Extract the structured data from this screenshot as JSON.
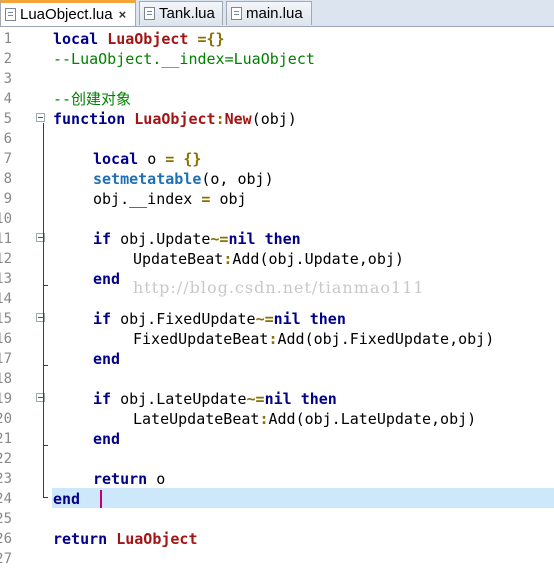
{
  "tabs": [
    {
      "label": "LuaObject.lua",
      "active": true,
      "close": "×"
    },
    {
      "label": "Tank.lua",
      "active": false
    },
    {
      "label": "main.lua",
      "active": false
    }
  ],
  "line_numbers": [
    "1",
    "2",
    "3",
    "4",
    "5",
    "6",
    "7",
    "8",
    "9",
    "10",
    "11",
    "12",
    "13",
    "14",
    "15",
    "16",
    "17",
    "18",
    "19",
    "20",
    "21",
    "22",
    "23",
    "24",
    "25",
    "26",
    "27"
  ],
  "code": {
    "l1": [
      "local",
      "LuaObject",
      "=",
      "{}"
    ],
    "l2": "--LuaObject.__index=LuaObject",
    "l4": "--创建对象",
    "l5": [
      "function",
      "LuaObject",
      ":",
      "New",
      "(obj)"
    ],
    "l7": [
      "local",
      "o",
      "=",
      "{}"
    ],
    "l8": [
      "setmetatable",
      "(o, obj)"
    ],
    "l9": [
      "obj.__index",
      "=",
      "obj"
    ],
    "l11": [
      "if",
      "obj.Update",
      "~=",
      "nil",
      "then"
    ],
    "l12": [
      "UpdateBeat",
      ":",
      "Add",
      "(obj.Update,obj)"
    ],
    "l13": "end",
    "l15": [
      "if",
      "obj.FixedUpdate",
      "~=",
      "nil",
      "then"
    ],
    "l16": [
      "FixedUpdateBeat",
      ":",
      "Add",
      "(obj.FixedUpdate,obj)"
    ],
    "l17": "end",
    "l19": [
      "if",
      "obj.LateUpdate",
      "~=",
      "nil",
      "then"
    ],
    "l20": [
      "LateUpdateBeat",
      ":",
      "Add",
      "(obj.LateUpdate,obj)"
    ],
    "l21": "end",
    "l23": [
      "return",
      "o"
    ],
    "l24": "end",
    "l26": [
      "return",
      "LuaObject"
    ]
  },
  "watermark": "http://blog.csdn.net/tianmao111",
  "colors": {
    "keyword": "#00008b",
    "comment": "#008000",
    "identifier": "#a31515",
    "current_line": "#cde8fb",
    "fold_marker": "#c00000"
  }
}
